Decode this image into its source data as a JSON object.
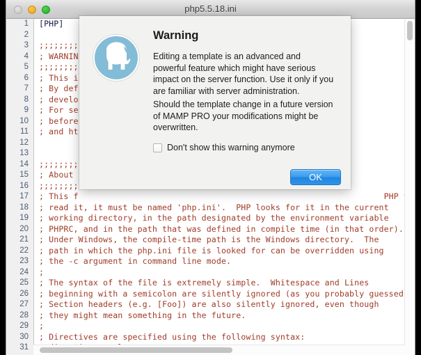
{
  "window": {
    "title": "php5.5.18.ini",
    "traffic_lights": [
      {
        "name": "close",
        "color": "#c6c6c6"
      },
      {
        "name": "minimize",
        "color": "#e9a020"
      },
      {
        "name": "maximize",
        "color": "#1fae2a"
      }
    ]
  },
  "editor": {
    "line_numbers": [
      1,
      2,
      3,
      4,
      5,
      6,
      7,
      8,
      9,
      10,
      11,
      12,
      13,
      14,
      15,
      16,
      17,
      18,
      19,
      20,
      21,
      22,
      23,
      24,
      25,
      26,
      27,
      28,
      29,
      30,
      31
    ],
    "lines": [
      "[PHP]",
      "",
      ";;;;;;;;;",
      "; WARNIN",
      ";;;;;;;;;",
      "; This i",
      "; By def",
      "; develo",
      "; For se",
      "; before                                                                    ended",
      "; and ht",
      "",
      "",
      ";;;;;;;;;",
      "; About",
      ";;;;;;;;",
      "; This f                                                              PHP to",
      "; read it, it must be named 'php.ini'.  PHP looks for it in the current",
      "; working directory, in the path designated by the environment variable",
      "; PHPRC, and in the path that was defined in compile time (in that order).",
      "; Under Windows, the compile-time path is the Windows directory.  The",
      "; path in which the php.ini file is looked for can be overridden using",
      "; the -c argument in command line mode.",
      ";",
      "; The syntax of the file is extremely simple.  Whitespace and Lines",
      "; beginning with a semicolon are silently ignored (as you probably guessed).",
      "; Section headers (e.g. [Foo]) are also silently ignored, even though",
      "; they might mean something in the future.",
      ";",
      "; Directives are specified using the following syntax:",
      "; directive = value"
    ],
    "comment_color": "#a03c28",
    "keyword_color": "#16194a",
    "gutter_color": "#f0f0f0"
  },
  "dialog": {
    "icon": "mamp-elephant-icon",
    "title": "Warning",
    "paragraph1": "Editing a template is an advanced and powerful feature which might have serious impact on the server function. Use it only if you are familiar with server administration.",
    "paragraph2": "Should the template change in a future version of MAMP PRO your modifications might be overwritten.",
    "checkbox_label": "Don't show this warning anymore",
    "checkbox_checked": false,
    "ok_label": "OK",
    "accent_color": "#2f93e8",
    "icon_color": "#83bcd6"
  }
}
